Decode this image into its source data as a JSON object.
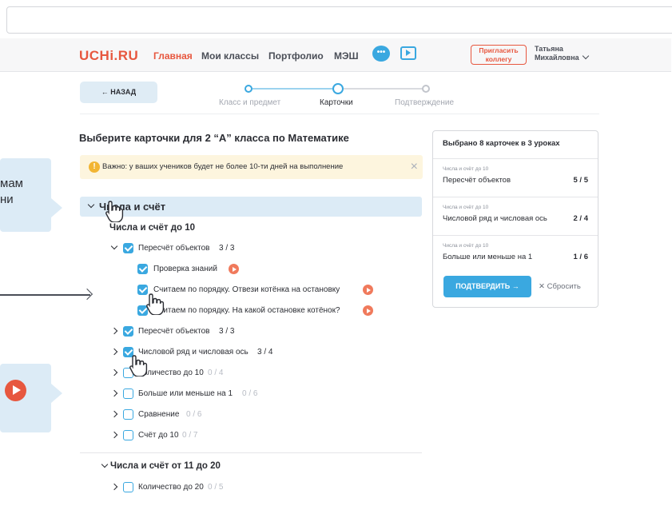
{
  "header": {
    "logo": "UCHi.RU",
    "nav": [
      "Главная",
      "Мои классы",
      "Портфолио",
      "МЭШ"
    ],
    "chat_icon_text": "•••",
    "invite_line1": "Пригласить",
    "invite_line2": "коллегу",
    "user_line1": "Татьяна",
    "user_line2": "Михайловна"
  },
  "back_label": "← НАЗАД",
  "steps": [
    "Класс и предмет",
    "Карточки",
    "Подтверждение"
  ],
  "heading": "Выберите карточки для 2 “А” класса по Математике",
  "warning": {
    "icon": "!",
    "text": "Важно: у ваших учеников будет не более 10-ти дней на выполнение",
    "close": "×"
  },
  "section1": "Числа и счёт",
  "subsection1": "Числа и счёт до 10",
  "tree": [
    {
      "label": "Пересчёт объектов",
      "count": "3 / 3"
    },
    {
      "label": "Проверка знаний"
    },
    {
      "label": "Считаем по порядку. Отвези котёнка на остановку"
    },
    {
      "label": "Считаем по порядку. На какой остановке котёнок?"
    },
    {
      "label": "Пересчёт объектов",
      "count": "3 / 3"
    },
    {
      "label": "Числовой ряд и числовая ось",
      "count": "3 / 4"
    },
    {
      "label": "Количество до 10",
      "count": "0 / 4"
    },
    {
      "label": "Больше или меньше на 1",
      "count": "0 / 6"
    },
    {
      "label": "Сравнение",
      "count": "0 / 6"
    },
    {
      "label": "Счёт до 10",
      "count": "0 / 7"
    }
  ],
  "subsection2": "Числа и счёт от 11 до 20",
  "tree2": [
    {
      "label": "Количество до 20",
      "count": "0 / 5"
    }
  ],
  "panel": {
    "title": "Выбрано 8 карточек в 3 уроках",
    "items": [
      {
        "caption": "Числа и счёт до 10",
        "name": "Пересчёт объектов",
        "count": "5 / 5"
      },
      {
        "caption": "Числа и счёт до 10",
        "name": "Числовой ряд и числовая ось",
        "count": "2 / 4"
      },
      {
        "caption": "Числа и счёт до 10",
        "name": "Больше или меньше на 1",
        "count": "1 / 6"
      }
    ],
    "confirm": "ПОДТВЕРДИТЬ →",
    "reset": "✕ Сбросить"
  },
  "callouts": {
    "left1_line1": "мам",
    "left1_line2": "ни"
  },
  "colors": {
    "accent": "#3aa8e0",
    "brand": "#e7573f",
    "highlight": "#dcebf6",
    "warning_bg": "#fdf5de"
  }
}
